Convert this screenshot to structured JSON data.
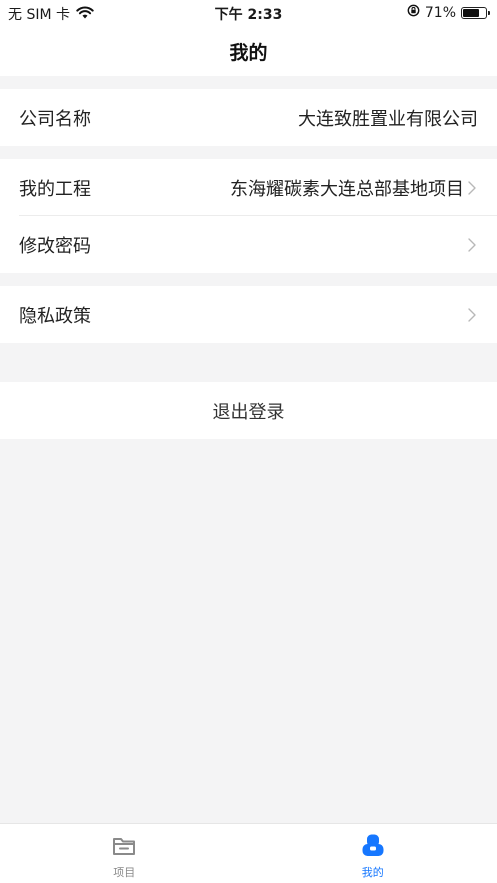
{
  "status_bar": {
    "carrier": "无 SIM 卡",
    "time": "下午 2:33",
    "battery": "71%",
    "battery_level": 0.71
  },
  "nav": {
    "title": "我的"
  },
  "company": {
    "label": "公司名称",
    "value": "大连致胜置业有限公司"
  },
  "project": {
    "label": "我的工程",
    "value": "东海耀碳素大连总部基地项目"
  },
  "password": {
    "label": "修改密码"
  },
  "privacy": {
    "label": "隐私政策"
  },
  "logout": {
    "label": "退出登录"
  },
  "tabs": [
    {
      "label": "项目",
      "icon": "folder-icon",
      "active": false
    },
    {
      "label": "我的",
      "icon": "user-icon",
      "active": true
    }
  ],
  "colors": {
    "accent": "#1677ff",
    "background": "#f4f4f5",
    "inactive_tab": "#8a8a8a"
  }
}
